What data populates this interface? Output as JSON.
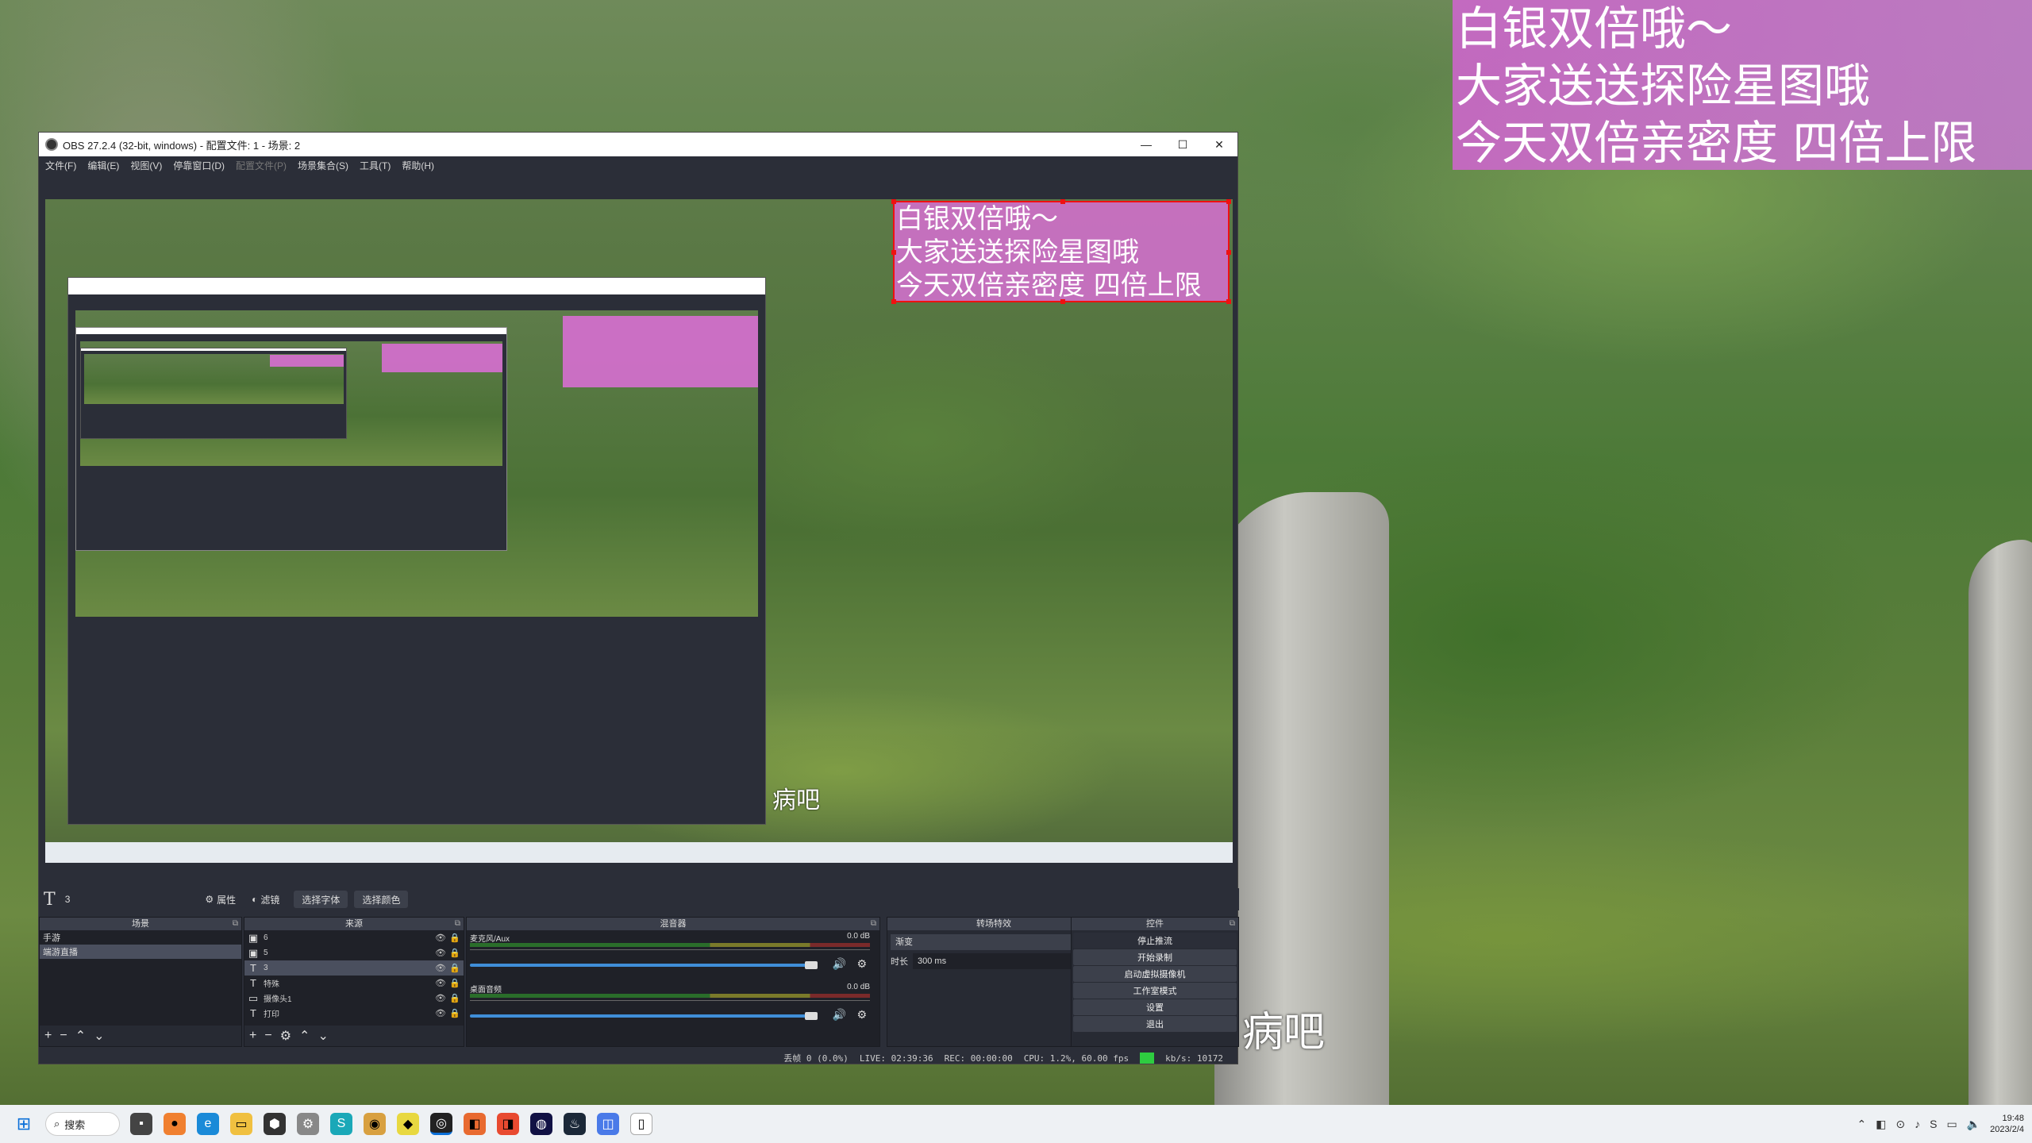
{
  "overlay": {
    "lines": [
      "白银双倍哦～",
      "大家送送探险星图哦",
      "今天双倍亲密度  四倍上限"
    ],
    "subtitle": "病吧"
  },
  "window": {
    "title": "OBS 27.2.4 (32-bit, windows) - 配置文件: 1 - 场景: 2",
    "minimize": "—",
    "maximize": "☐",
    "close": "✕"
  },
  "menu": {
    "items": [
      "文件(F)",
      "编辑(E)",
      "视图(V)",
      "停靠窗口(D)",
      "配置文件(P)",
      "场景集合(S)",
      "工具(T)",
      "帮助(H)"
    ]
  },
  "preview": {
    "caption_lines": [
      "白银双倍哦～",
      "大家送送探险星图哦",
      "今天双倍亲密度  四倍上限"
    ],
    "subtitle": "病吧"
  },
  "propbar": {
    "source_glyph": "T",
    "source_name": "3",
    "properties": "属性",
    "filters": "滤镜",
    "select_font": "选择字体",
    "select_color": "选择颜色"
  },
  "scenes": {
    "title": "场景",
    "items": [
      "手游",
      "端游直播"
    ]
  },
  "sources": {
    "title": "来源",
    "items": [
      {
        "icon": "image-icon",
        "glyph": "▣",
        "label": "6"
      },
      {
        "icon": "image-icon",
        "glyph": "▣",
        "label": "5"
      },
      {
        "icon": "text-icon",
        "glyph": "T",
        "label": "3"
      },
      {
        "icon": "text-icon",
        "glyph": "T",
        "label": "特殊"
      },
      {
        "icon": "camera-icon",
        "glyph": "▭",
        "label": "摄像头1"
      },
      {
        "icon": "text-icon",
        "glyph": "T",
        "label": "打印"
      }
    ]
  },
  "mixer": {
    "title": "混音器",
    "channels": [
      {
        "name": "麦克风/Aux",
        "db": "0.0 dB"
      },
      {
        "name": "桌面音频",
        "db": "0.0 dB"
      }
    ]
  },
  "transitions": {
    "title": "转场特效",
    "type": "渐变",
    "duration_label": "时长",
    "duration_value": "300 ms"
  },
  "controls": {
    "title": "控件",
    "buttons": [
      "停止推流",
      "开始录制",
      "启动虚拟摄像机",
      "工作室模式",
      "设置",
      "退出"
    ]
  },
  "status": {
    "dropped": "丢帧 0 (0.0%)",
    "live": "LIVE: 02:39:36",
    "rec": "REC: 00:00:00",
    "cpu": "CPU: 1.2%, 60.00 fps",
    "bitrate": "kb/s: 10172"
  },
  "taskbar": {
    "search": "搜索",
    "time": "19:48",
    "date": "2023/2/4"
  },
  "colors": {
    "accent": "#3f8ed8",
    "caption_bg": "#d26ed2",
    "live_green": "#2ecc40",
    "selection_red": "#ee1111"
  }
}
